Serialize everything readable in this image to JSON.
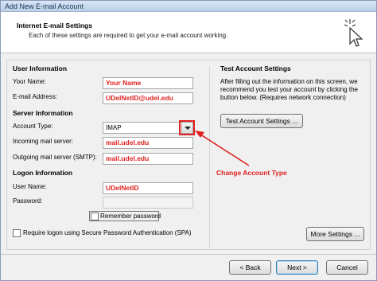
{
  "window": {
    "title": "Add New E-mail Account"
  },
  "header": {
    "title": "Internet E-mail Settings",
    "subtitle": "Each of these settings are required to get your e-mail account working."
  },
  "user_info": {
    "section": "User Information",
    "name_label": "Your Name:",
    "name_value": "Your Name",
    "email_label": "E-mail Address:",
    "email_value": "UDelNetID@udel.edu"
  },
  "server_info": {
    "section": "Server Information",
    "account_type_label": "Account Type:",
    "account_type_value": "IMAP",
    "incoming_label": "Incoming mail server:",
    "incoming_value": "mail.udel.edu",
    "outgoing_label": "Outgoing mail server (SMTP):",
    "outgoing_value": "mail.udel.edu"
  },
  "logon_info": {
    "section": "Logon Information",
    "username_label": "User Name:",
    "username_value": "UDelNetID",
    "password_label": "Password:",
    "password_value": "",
    "remember_label": "Remember password"
  },
  "spa_label": "Require logon using Secure Password Authentication (SPA)",
  "test_settings": {
    "section": "Test Account Settings",
    "description_1": "After filling out the information on this screen, we",
    "description_2": "recommend you test your account by clicking the",
    "description_3": "button below.  (Requires network connection)",
    "button": "Test Account Settings ..."
  },
  "more_settings_button": "More Settings ...",
  "annotation": "Change Account Type",
  "footer": {
    "back_button": "< Back",
    "next_button": "Next >",
    "cancel_button": "Cancel"
  },
  "colors": {
    "annotation": "#e02020",
    "header_bg": "#ffffff"
  },
  "icons": {
    "header": "cursor-click-icon",
    "dropdown": "chevron-down-icon"
  }
}
